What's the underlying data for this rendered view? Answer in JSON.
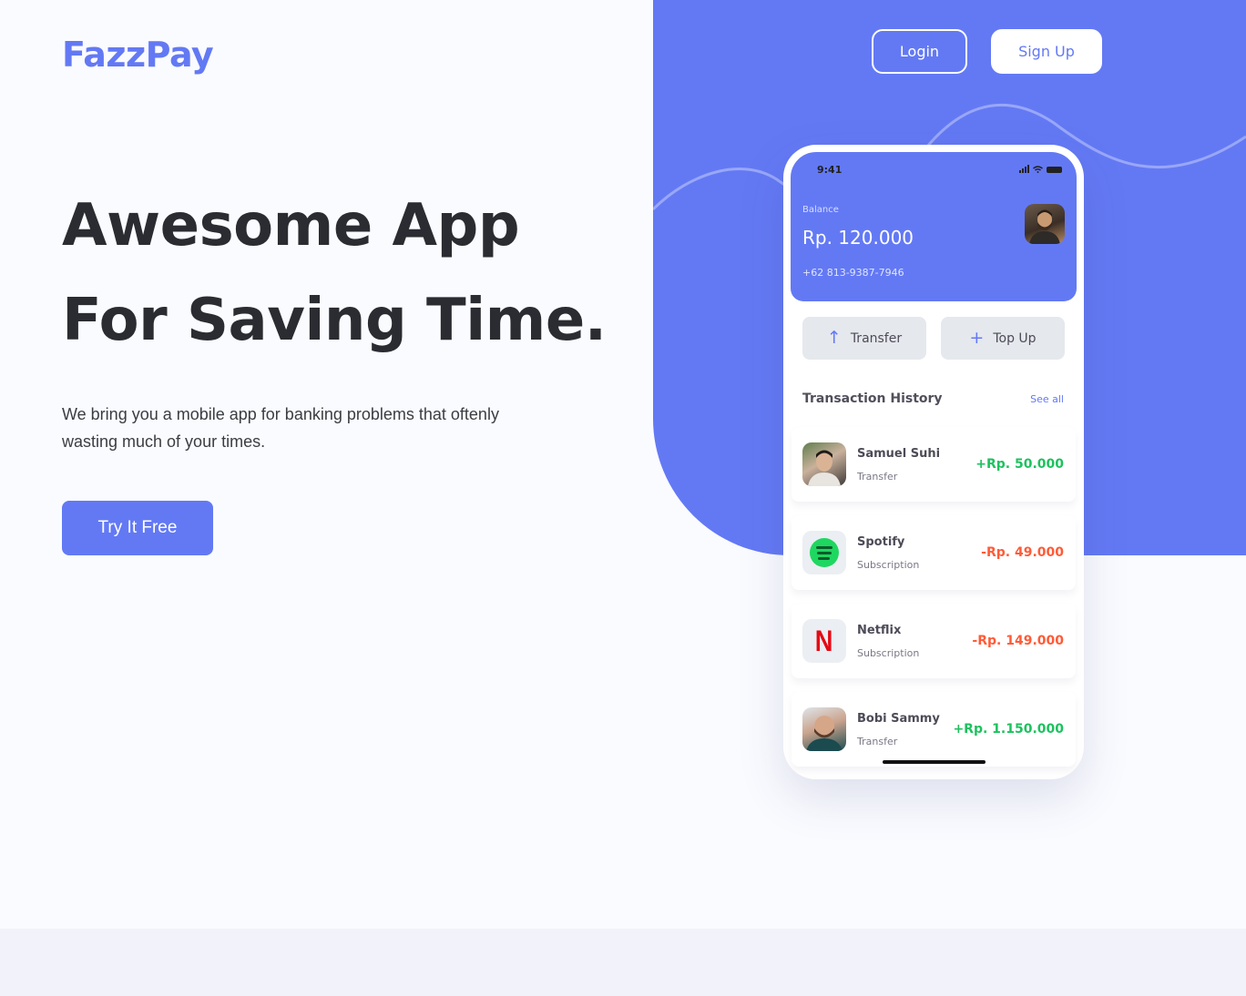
{
  "brand": {
    "logo_text": "FazzPay",
    "accent_color": "#6379F4"
  },
  "nav": {
    "login_label": "Login",
    "signup_label": "Sign Up"
  },
  "hero": {
    "title_line_1": "Awesome App",
    "title_line_2": "For Saving Time.",
    "description": "We bring you a mobile app for banking problems that oftenly wasting much of your times.",
    "cta_label": "Try It Free"
  },
  "phone": {
    "status_time": "9:41",
    "balance_label": "Balance",
    "balance_amount": "Rp. 120.000",
    "phone_number": "+62 813-9387-7946",
    "actions": {
      "transfer_label": "Transfer",
      "topup_label": "Top Up",
      "transfer_icon": "arrow-up-icon",
      "topup_icon": "plus-icon"
    },
    "history_title": "Transaction History",
    "see_all_label": "See all",
    "transactions": [
      {
        "name": "Samuel Suhi",
        "type": "Transfer",
        "amount": "+Rp. 50.000",
        "direction": "in"
      },
      {
        "name": "Spotify",
        "type": "Subscription",
        "amount": "-Rp. 49.000",
        "direction": "out"
      },
      {
        "name": "Netflix",
        "type": "Subscription",
        "amount": "-Rp. 149.000",
        "direction": "out"
      },
      {
        "name": "Bobi Sammy",
        "type": "Transfer",
        "amount": "+Rp. 1.150.000",
        "direction": "in"
      }
    ],
    "colors": {
      "positive": "#1EC15F",
      "negative": "#FF5B37"
    }
  }
}
